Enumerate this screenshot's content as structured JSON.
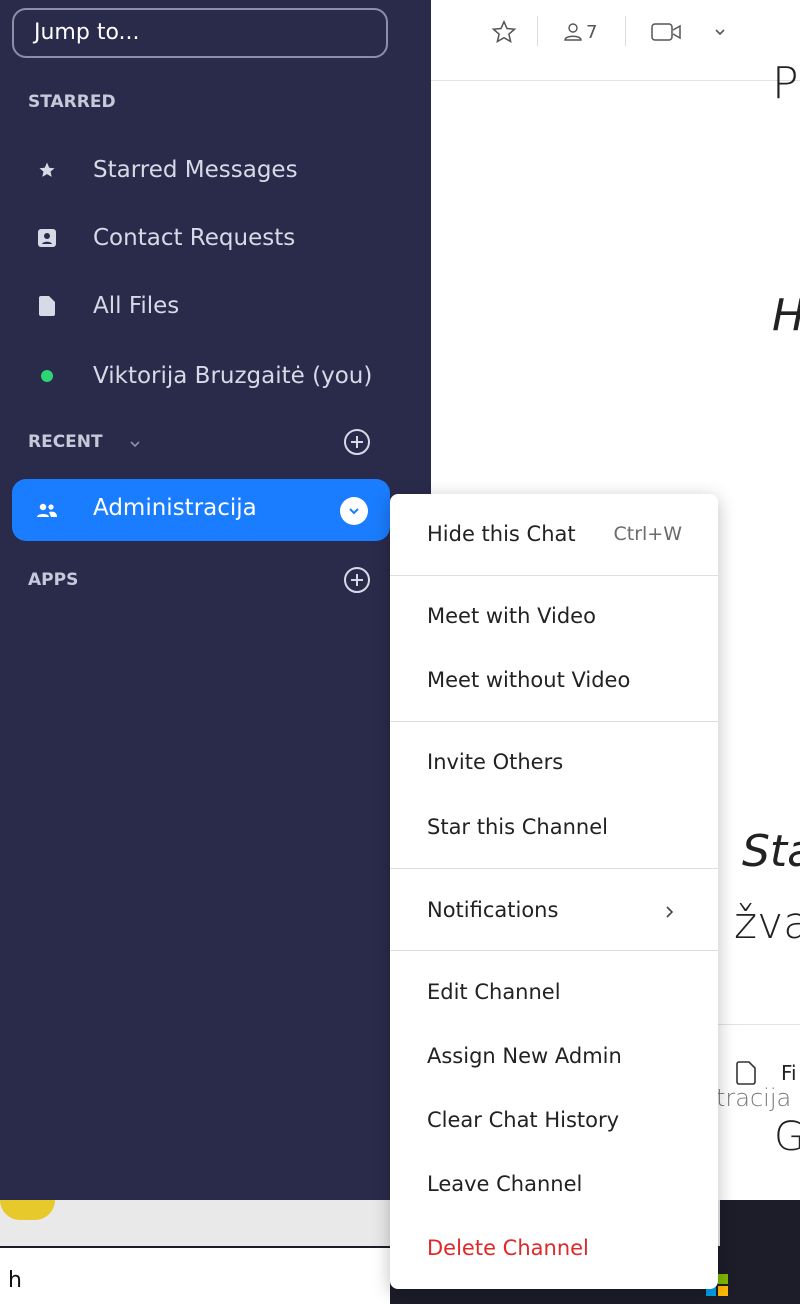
{
  "sidebar": {
    "jump_placeholder": "Jump to...",
    "starred_label": "STARRED",
    "starred_items": [
      {
        "label": "Starred Messages",
        "icon": "star-icon"
      },
      {
        "label": "Contact Requests",
        "icon": "contact-card-icon"
      },
      {
        "label": "All Files",
        "icon": "file-icon"
      },
      {
        "label": "Viktorija Bruzgaitė (you)",
        "icon": "presence-dot-icon"
      }
    ],
    "recent_label": "RECENT",
    "active_channel": "Administracija",
    "apps_label": "APPS"
  },
  "topbar": {
    "member_count": "7"
  },
  "chat": {
    "fragments": [
      "P",
      "H",
      "Sta",
      "žva",
      "tracija",
      "G"
    ],
    "files_label": "Fi"
  },
  "menu": {
    "items": [
      {
        "label": "Hide this Chat",
        "shortcut": "Ctrl+W"
      },
      {
        "label": "Meet with Video"
      },
      {
        "label": "Meet without Video"
      },
      {
        "label": "Invite Others"
      },
      {
        "label": "Star this Channel"
      },
      {
        "label": "Notifications"
      },
      {
        "label": "Edit Channel"
      },
      {
        "label": "Assign New Admin"
      },
      {
        "label": "Clear Chat History"
      },
      {
        "label": "Leave Channel"
      },
      {
        "label": "Delete Channel"
      }
    ]
  },
  "taskbar": {
    "search_text": "h"
  },
  "colors": {
    "sidebar_bg": "#2a2b4b",
    "accent": "#1a7dff",
    "danger": "#e02828",
    "presence": "#2ed573"
  }
}
